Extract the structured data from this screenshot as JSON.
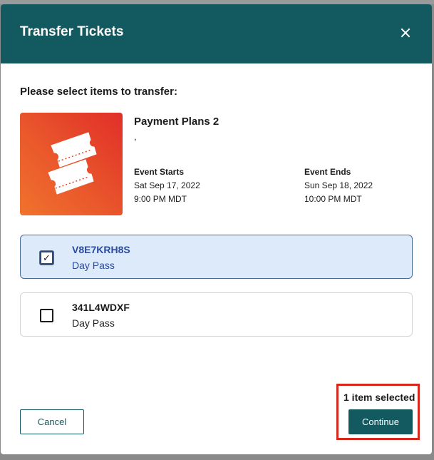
{
  "modal": {
    "title": "Transfer Tickets",
    "close_icon": "close-icon"
  },
  "instruction": "Please select items to transfer:",
  "event": {
    "name": "Payment Plans 2",
    "subtitle": ",",
    "thumbnail_icon": "ticket-icon",
    "starts": {
      "label": "Event Starts",
      "date": "Sat Sep 17, 2022",
      "time": "9:00 PM MDT"
    },
    "ends": {
      "label": "Event Ends",
      "date": "Sun Sep 18, 2022",
      "time": "10:00 PM MDT"
    }
  },
  "tickets": [
    {
      "code": "V8E7KRH8S",
      "type": "Day Pass",
      "checked": true,
      "check_mark": "✓"
    },
    {
      "code": "341L4WDXF",
      "type": "Day Pass",
      "checked": false,
      "check_mark": ""
    }
  ],
  "footer": {
    "selected_count": "1 item selected",
    "cancel_label": "Cancel",
    "continue_label": "Continue"
  },
  "colors": {
    "header": "#135a60",
    "selected_bg": "#dceafa",
    "highlight": "#d6281c",
    "thumbnail": "#e8452b"
  }
}
